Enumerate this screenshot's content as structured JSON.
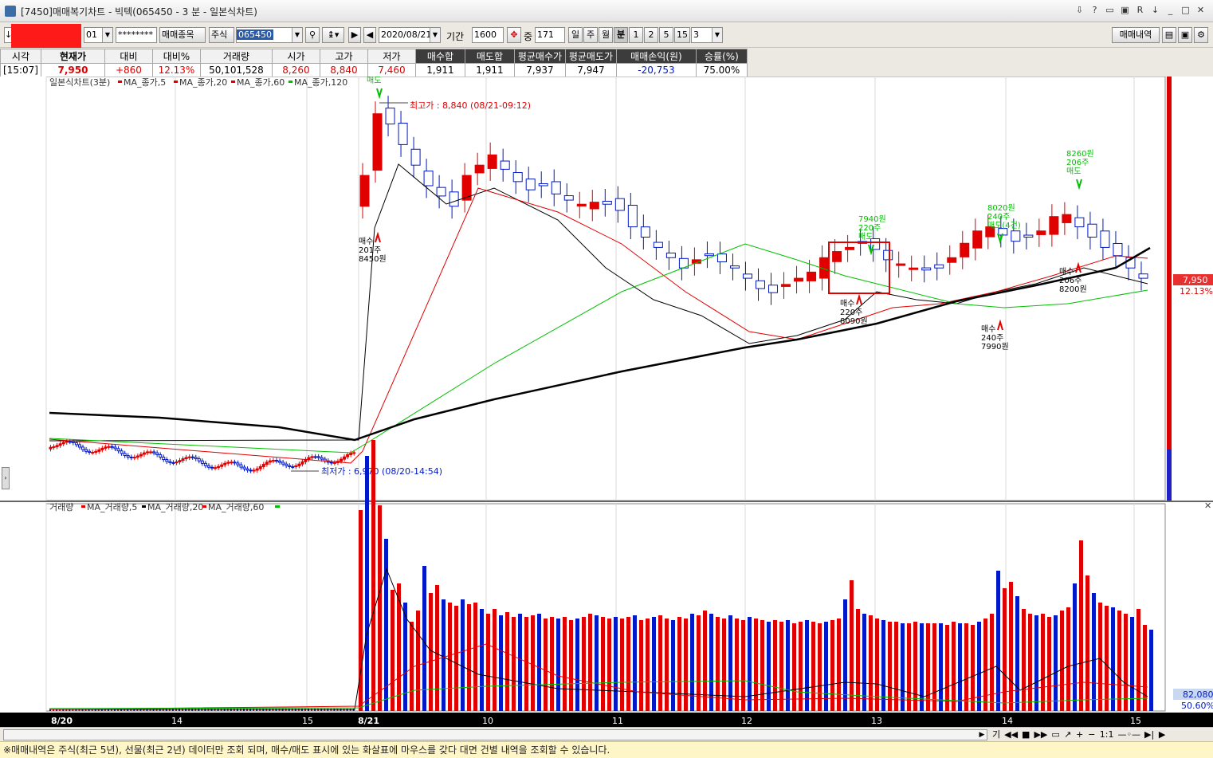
{
  "window": {
    "title": "[7450]매매복기차트 - 빅텍(065450 - 3 분 - 일본식차트)"
  },
  "toolbar": {
    "account_select": "01",
    "password": "********",
    "trade_item_btn": "매매종목",
    "market_btn": "주식",
    "code": "065450",
    "date": "2020/08/21",
    "period_label": "기간",
    "period_value": "1600",
    "count_label": "중",
    "count_value": "171",
    "day": "일",
    "week": "주",
    "month": "월",
    "minute": "분",
    "n1": "1",
    "n2": "2",
    "n5": "5",
    "n15": "15",
    "interval": "3",
    "trade_history_btn": "매매내역"
  },
  "info": {
    "headers": [
      "시각",
      "현재가",
      "대비",
      "대비%",
      "거래량",
      "시가",
      "고가",
      "저가",
      "매수합",
      "매도합",
      "평균매수가",
      "평균매도가",
      "매매손익(원)",
      "승률(%)"
    ],
    "values": [
      "[15:07]",
      "7,950",
      "+860",
      "12.13%",
      "50,101,528",
      "8,260",
      "8,840",
      "7,460",
      "1,911",
      "1,911",
      "7,937",
      "7,947",
      "-20,753",
      "75.00%"
    ]
  },
  "price_chart": {
    "title": "일본식차트(3분)",
    "legend": [
      "MA_종가,5",
      "MA_종가,20",
      "MA_종가,60",
      "MA_종가,120"
    ],
    "high_label": "최고가 : 8,840 (08/21-09:12)",
    "low_label": "최저가 : 6,970 (08/20-14:54)",
    "current_price": "7,950",
    "current_pct": "12.13%"
  },
  "annotations": [
    {
      "text": [
        "매도"
      ],
      "type": "sell"
    },
    {
      "text": [
        "매수",
        "201주",
        "8450원"
      ],
      "type": "buy"
    },
    {
      "text": [
        "7940원",
        "220주",
        "매도"
      ],
      "type": "sell"
    },
    {
      "text": [
        "매수",
        "220주",
        "8090원"
      ],
      "type": "buy"
    },
    {
      "text": [
        "8020원",
        "240주",
        "매도(4건)"
      ],
      "type": "sell"
    },
    {
      "text": [
        "매수",
        "240주",
        "7990원"
      ],
      "type": "buy"
    },
    {
      "text": [
        "8260원",
        "206주",
        "매도"
      ],
      "type": "sell"
    },
    {
      "text": [
        "매수",
        "206주",
        "8200원"
      ],
      "type": "buy"
    }
  ],
  "volume_chart": {
    "title": "거래량",
    "legend": [
      "MA_거래량,5",
      "MA_거래량,20",
      "MA_거래량,60"
    ],
    "current_volume": "82,080",
    "current_pct": "50.60%"
  },
  "x_axis": [
    "8/20",
    "14",
    "15",
    "8/21",
    "10",
    "11",
    "12",
    "13",
    "14",
    "15"
  ],
  "navigation": {
    "ratio": "1:1"
  },
  "status": {
    "text": "※매매내역은 주식(최근 5년), 선물(최근 2년) 데이터만 조회 되며, 매수/매도 표시에 있는 화살표에 마우스를 갖다 대면 건별 내역을 조회할 수 있습니다."
  },
  "chart_data": {
    "type": "candlestick",
    "title": "일본식차트(3분)",
    "ylim": [
      6900,
      8900
    ],
    "series": [
      {
        "name": "MA_종가,5",
        "color": "#000000"
      },
      {
        "name": "MA_종가,20",
        "color": "#e00000"
      },
      {
        "name": "MA_종가,60",
        "color": "#00c000"
      },
      {
        "name": "MA_종가,120",
        "color": "#000000"
      }
    ],
    "closes_day2": [
      8450,
      8750,
      8700,
      8600,
      8500,
      8400,
      8350,
      8300,
      8450,
      8500,
      8550,
      8480,
      8420,
      8380,
      8400,
      8360,
      8330,
      8310,
      8320,
      8310,
      8280,
      8200,
      8150,
      8100,
      8050,
      8000,
      8040,
      8060,
      8030,
      8000,
      7950,
      7900,
      7880,
      7920,
      7950,
      7980,
      8050,
      8080,
      8100,
      8120,
      8090,
      8040,
      8020,
      8000,
      7990,
      8000,
      8050,
      8120,
      8180,
      8200,
      8160,
      8130,
      8150,
      8180,
      8250,
      8260,
      8200,
      8150,
      8100,
      8060,
      8000,
      7950
    ],
    "volume_max": "~1,600,000"
  }
}
